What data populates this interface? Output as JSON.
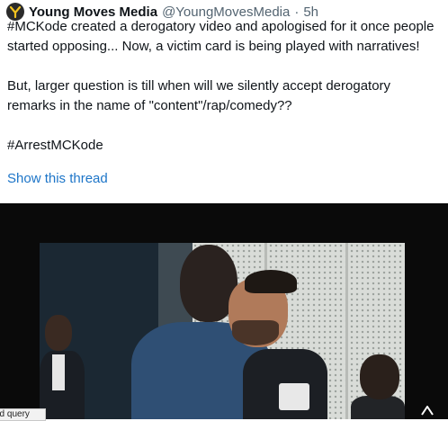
{
  "tweet": {
    "author": {
      "display_name": "Young Moves Media",
      "handle": "@YoungMovesMedia",
      "separator": "·",
      "time": "5h",
      "avatar_icon": "ym-logo-avatar"
    },
    "paragraphs": [
      "#MCKode created a derogatory video and apologised for it once people started opposing... Now, a victim card is being played with narratives!",
      "But, larger question is till when will we silently accept derogatory remarks in the name of \"content\"/rap/comedy??",
      "#ArrestMCKode"
    ],
    "show_thread": "Show this thread"
  },
  "media": {
    "type": "video",
    "overlay_icon": "video-badge-icon"
  },
  "tooltip": {
    "text": "ed query"
  },
  "colors": {
    "text": "#0f1419",
    "muted": "#536471",
    "link": "#1d75c8",
    "media_bg": "#0a0a0a"
  }
}
